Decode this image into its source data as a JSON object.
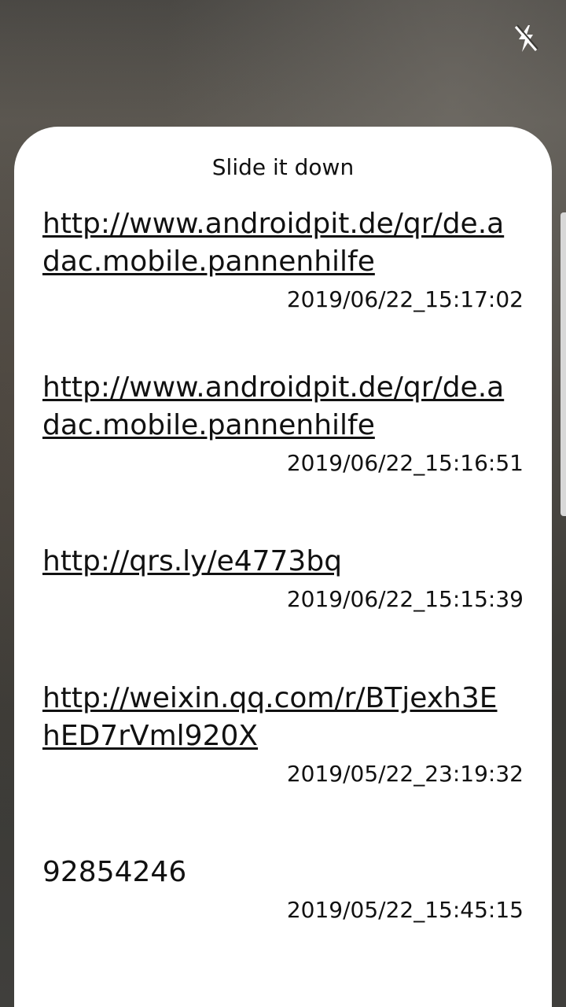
{
  "sheet": {
    "title": "Slide it down"
  },
  "history": [
    {
      "text": "http://www.androidpit.de/qr/de.adac.mobile.pannenhilfe",
      "time": "2019/06/22_15:17:02",
      "is_link": true
    },
    {
      "text": "http://www.androidpit.de/qr/de.adac.mobile.pannenhilfe",
      "time": "2019/06/22_15:16:51",
      "is_link": true
    },
    {
      "text": "http://qrs.ly/e4773bq",
      "time": "2019/06/22_15:15:39",
      "is_link": true
    },
    {
      "text": "http://weixin.qq.com/r/BTjexh3EhED7rVml920X",
      "time": "2019/05/22_23:19:32",
      "is_link": true
    },
    {
      "text": "92854246",
      "time": "2019/05/22_15:45:15",
      "is_link": false
    }
  ],
  "icons": {
    "flash": "flash-off-icon"
  },
  "colors": {
    "sheet_bg": "#ffffff",
    "text": "#111111",
    "handle": "#d8d8d8"
  }
}
